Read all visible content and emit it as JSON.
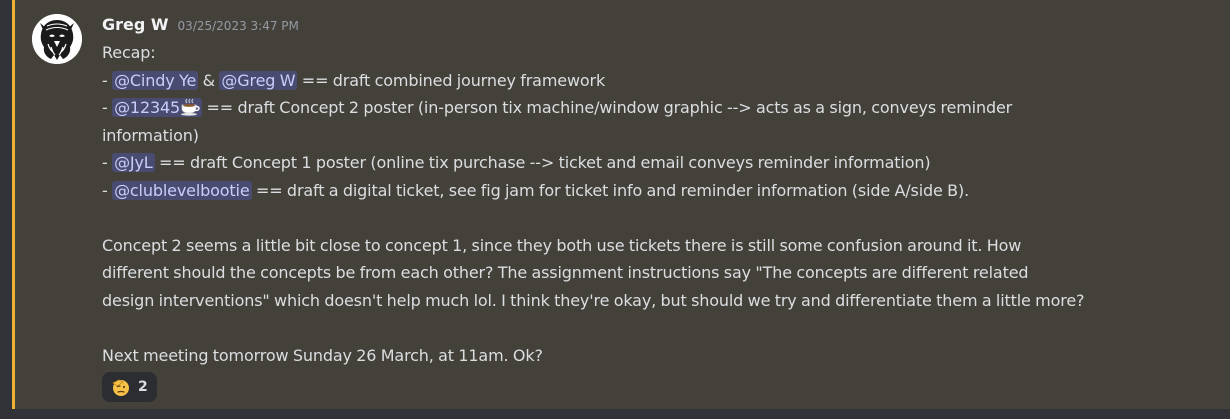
{
  "message": {
    "author": "Greg W",
    "timestamp": "03/25/2023 3:47 PM",
    "avatar_icon": "wolf-head-icon",
    "highlight_color": "#f0b232",
    "lines": {
      "recap": "Recap:",
      "dash1": "- ",
      "mention_cindy": "@Cindy Ye",
      "amp": " & ",
      "mention_greg": "@Greg W",
      "task1": " == draft combined journey framework",
      "dash2": "- ",
      "mention_12345": "@12345",
      "task2a": " == draft Concept 2 poster (in-person tix machine/window graphic --> acts as a sign, conveys reminder",
      "task2b": "information)",
      "dash3": "- ",
      "mention_jyl": "@JyL",
      "task3": " == draft Concept 1 poster (online tix purchase --> ticket and email conveys reminder information)",
      "dash4": "- ",
      "mention_clublevel": "@clublevelbootie",
      "task4": " == draft a digital ticket, see fig jam for ticket info and reminder information (side A/side B).",
      "para1a": "Concept 2 seems a little bit close to concept 1, since they both use tickets there is still some confusion around it. How",
      "para1b": "different should the concepts be from each other? The assignment instructions say \"The concepts are different related",
      "para1c": "design interventions\" which doesn't help much lol. I think they're okay, but should we try and differentiate them a little more?",
      "para2": "Next meeting tomorrow Sunday 26 March, at 11am. Ok?"
    },
    "mention_icon": "coffee-cup-icon",
    "reactions": [
      {
        "icon": "saluting-face-icon",
        "count": "2"
      }
    ]
  }
}
